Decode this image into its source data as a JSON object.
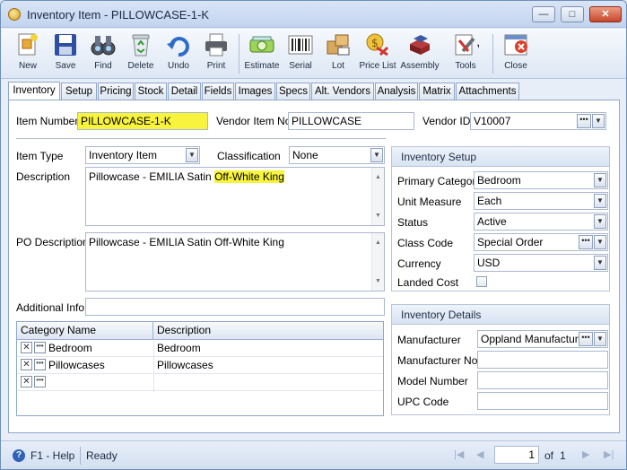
{
  "window": {
    "title": "Inventory Item - PILLOWCASE-1-K"
  },
  "toolbar": {
    "items": [
      {
        "label": "New"
      },
      {
        "label": "Save"
      },
      {
        "label": "Find"
      },
      {
        "label": "Delete"
      },
      {
        "label": "Undo"
      },
      {
        "label": "Print"
      },
      {
        "label": "Estimate"
      },
      {
        "label": "Serial"
      },
      {
        "label": "Lot"
      },
      {
        "label": "Price List"
      },
      {
        "label": "Assembly"
      },
      {
        "label": "Tools"
      },
      {
        "label": "Close"
      }
    ]
  },
  "tabs": [
    "Inventory",
    "Setup",
    "Pricing",
    "Stock",
    "Detail",
    "Fields",
    "Images",
    "Specs",
    "Alt. Vendors",
    "Analysis",
    "Matrix",
    "Attachments"
  ],
  "header": {
    "item_number_label": "Item Number",
    "item_number": "PILLOWCASE-1-K",
    "vendor_item_no_label": "Vendor Item No",
    "vendor_item_no": "PILLOWCASE",
    "vendor_id_label": "Vendor ID",
    "vendor_id": "V10007"
  },
  "main": {
    "item_type_label": "Item Type",
    "item_type": "Inventory Item",
    "classification_label": "Classification",
    "classification": "None",
    "description_label": "Description",
    "description_part1": "Pillowcase - EMILIA Satin ",
    "description_part2": "Off-White King",
    "po_description_label": "PO Description",
    "po_description": "Pillowcase - EMILIA Satin Off-White King",
    "additional_info_label": "Additional Info",
    "additional_info": ""
  },
  "category_grid": {
    "headers": [
      "Category Name",
      "Description"
    ],
    "rows": [
      {
        "name": "Bedroom",
        "description": "Bedroom"
      },
      {
        "name": "Pillowcases",
        "description": "Pillowcases"
      },
      {
        "name": "",
        "description": ""
      }
    ]
  },
  "inventory_setup": {
    "title": "Inventory Setup",
    "primary_category_label": "Primary Category",
    "primary_category": "Bedroom",
    "unit_measure_label": "Unit Measure",
    "unit_measure": "Each",
    "status_label": "Status",
    "status": "Active",
    "class_code_label": "Class Code",
    "class_code": "Special Order",
    "currency_label": "Currency",
    "currency": "USD",
    "landed_cost_label": "Landed Cost",
    "landed_cost": false
  },
  "inventory_details": {
    "title": "Inventory Details",
    "manufacturer_label": "Manufacturer",
    "manufacturer": "Oppland Manufacturing",
    "manufacturer_no_label": "Manufacturer No",
    "manufacturer_no": "",
    "model_number_label": "Model Number",
    "model_number": "",
    "upc_code_label": "UPC Code",
    "upc_code": ""
  },
  "statusbar": {
    "help": "F1 - Help",
    "status": "Ready",
    "page": "1",
    "of_label": "of",
    "total": "1"
  }
}
